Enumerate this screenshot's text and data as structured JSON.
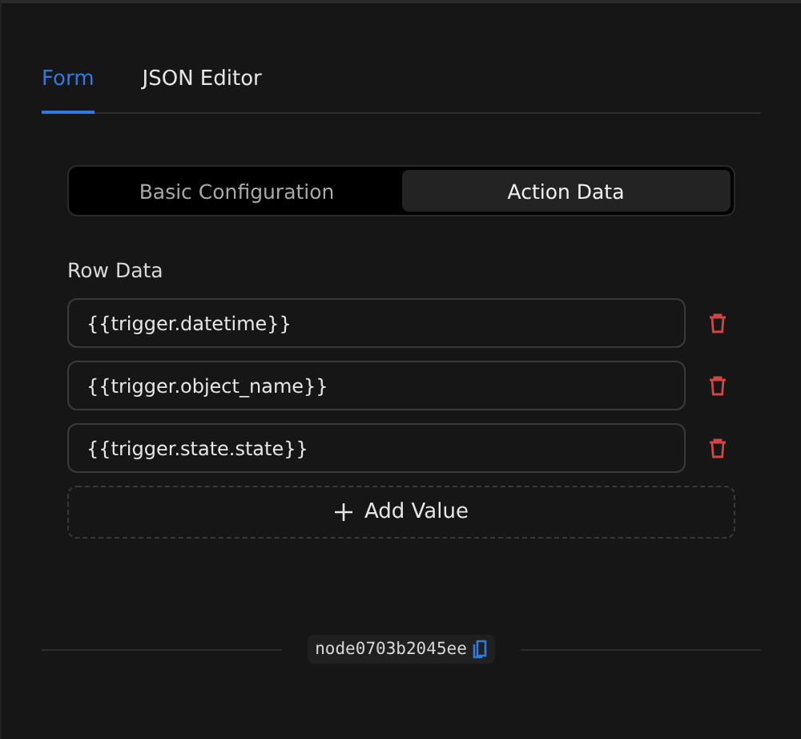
{
  "tabs": [
    {
      "label": "Form",
      "selected": true
    },
    {
      "label": "JSON Editor",
      "selected": false
    }
  ],
  "segments": [
    {
      "label": "Basic Configuration",
      "selected": false
    },
    {
      "label": "Action Data",
      "selected": true
    }
  ],
  "row_data": {
    "label": "Row Data",
    "values": [
      "{{trigger.datetime}}",
      "{{trigger.object_name}}",
      "{{trigger.state.state}}"
    ],
    "add_button": "Add Value"
  },
  "node_id": "node0703b2045ee"
}
